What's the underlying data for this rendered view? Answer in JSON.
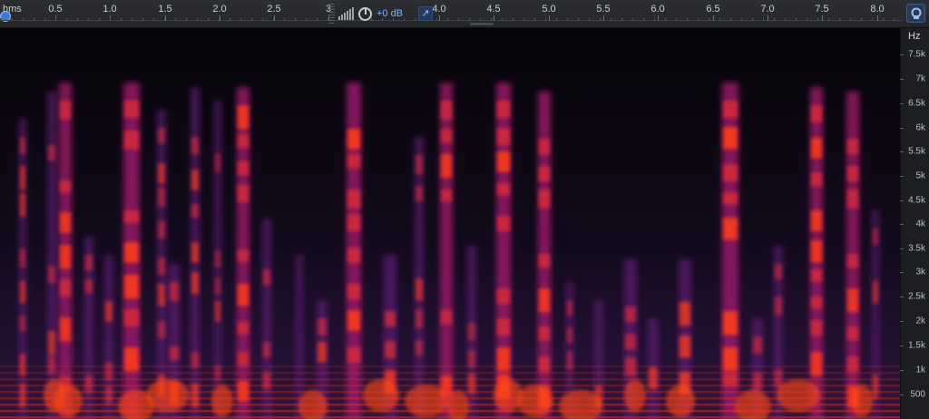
{
  "ruler": {
    "unit_label": "hms",
    "ticks": [
      "0.5",
      "1.0",
      "1.5",
      "2.0",
      "2.5",
      "3",
      "4.0",
      "4.5",
      "5.0",
      "5.5",
      "6.0",
      "6.5",
      "7.0",
      "7.5",
      "8.0"
    ]
  },
  "hud": {
    "gain_label": "+0 dB",
    "icons": [
      "level-meter-icon",
      "gain-knob-icon",
      "pin-icon"
    ]
  },
  "freq_axis": {
    "unit": "Hz",
    "labels": [
      "7.5k",
      "7k",
      "6.5k",
      "6k",
      "5.5k",
      "5k",
      "4.5k",
      "4k",
      "3.5k",
      "3k",
      "2.5k",
      "2k",
      "1.5k",
      "1k",
      "500"
    ]
  },
  "zoom_button": {
    "icon": "magnifier-icon"
  },
  "colors": {
    "spectrogram_low": "#08060a",
    "spectrogram_mid": "#6b1a8a",
    "spectrogram_high": "#ff2a10",
    "accent": "#3a7bd5",
    "gain_text": "#7fb6ff"
  }
}
